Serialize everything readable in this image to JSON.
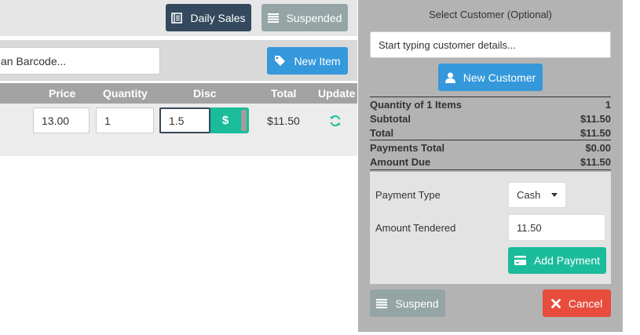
{
  "toolbar": {
    "daily_sales_label": "Daily Sales",
    "suspended_label": "Suspended"
  },
  "item_search": {
    "placeholder": "an Barcode...",
    "new_item_label": "New Item"
  },
  "cart_table": {
    "headers": {
      "price": "Price",
      "quantity": "Quantity",
      "disc": "Disc",
      "total": "Total",
      "update": "Update"
    },
    "rows": [
      {
        "price": "13.00",
        "quantity": "1",
        "disc": "1.5",
        "disc_type_symbol": "$",
        "total": "$11.50"
      }
    ]
  },
  "customer": {
    "title": "Select Customer (Optional)",
    "search_placeholder": "Start typing customer details...",
    "new_customer_label": "New Customer"
  },
  "summary": {
    "quantity_label": "Quantity of 1 Items",
    "quantity_value": "1",
    "subtotal_label": "Subtotal",
    "subtotal_value": "$11.50",
    "total_label": "Total",
    "total_value": "$11.50",
    "payments_total_label": "Payments Total",
    "payments_total_value": "$0.00",
    "amount_due_label": "Amount Due",
    "amount_due_value": "$11.50"
  },
  "payment": {
    "type_label": "Payment Type",
    "type_value": "Cash",
    "tendered_label": "Amount Tendered",
    "tendered_value": "11.50",
    "add_payment_label": "Add Payment"
  },
  "actions": {
    "suspend_label": "Suspend",
    "cancel_label": "Cancel"
  },
  "colors": {
    "dark_navy": "#34495e",
    "grey_button": "#95a5a6",
    "blue_button": "#3498db",
    "teal_button": "#1abc9c",
    "red_button": "#e74c3c"
  },
  "icons": {
    "daily_sales": "ledger-icon",
    "suspended": "list-icon",
    "new_item": "tag-icon",
    "update": "refresh-icon",
    "new_customer": "user-icon",
    "add_payment": "credit-card-icon",
    "suspend": "list-icon",
    "cancel": "close-icon"
  }
}
